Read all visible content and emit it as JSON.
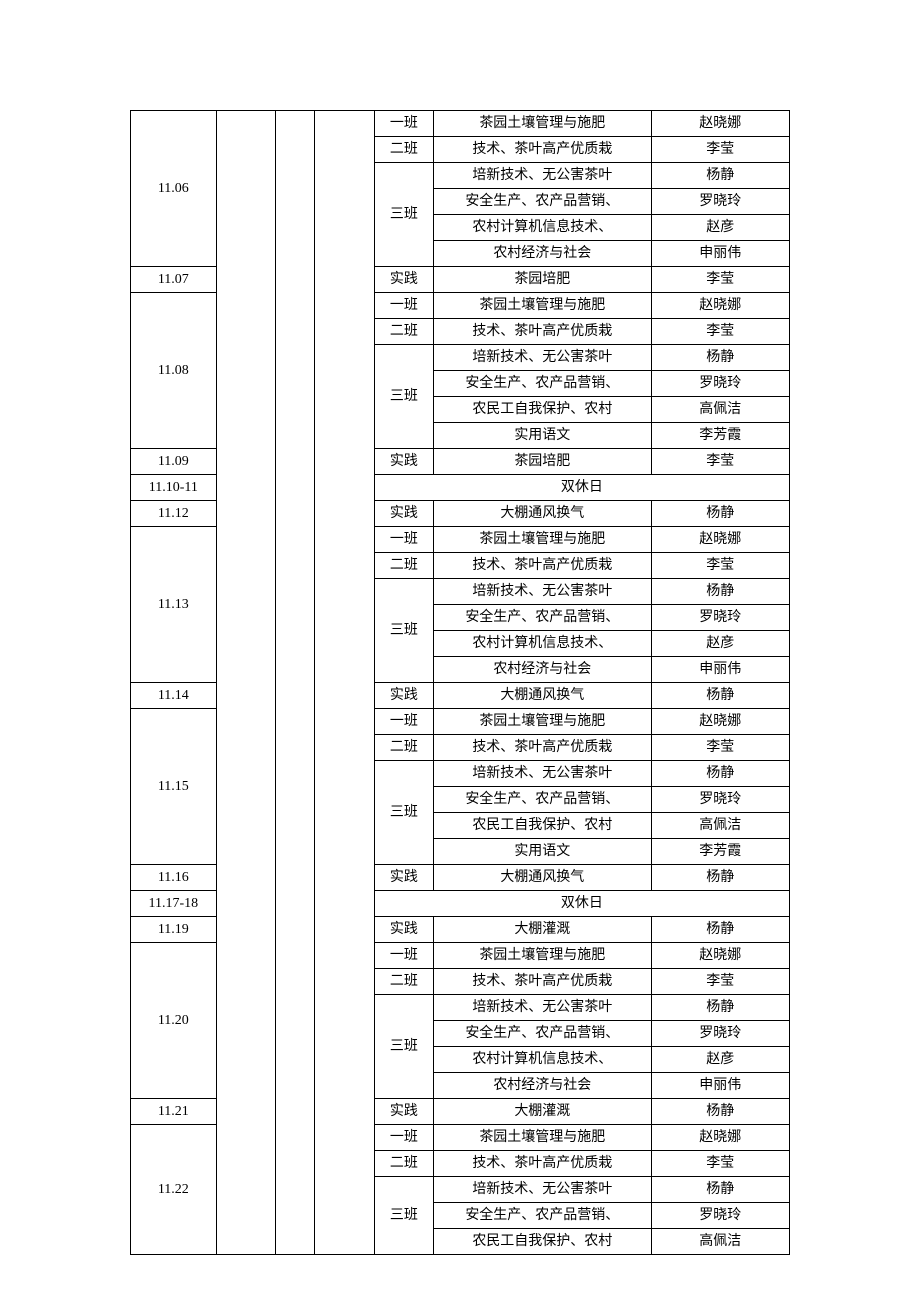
{
  "rows": [
    {
      "date": "11.06",
      "dateRows": 6,
      "classes": [
        {
          "cls": "一班",
          "clsRows": 1,
          "subject": "茶园土壤管理与施肥",
          "teacher": "赵晓娜"
        },
        {
          "cls": "二班",
          "clsRows": 1,
          "subject": "技术、茶叶高产优质栽",
          "teacher": "李莹"
        },
        {
          "cls": "三班",
          "clsRows": 4,
          "subject": "培新技术、无公害茶叶",
          "teacher": "杨静"
        },
        {
          "subject": "安全生产、农产品营销、",
          "teacher": "罗晓玲"
        },
        {
          "subject": "农村计算机信息技术、",
          "teacher": "赵彦"
        },
        {
          "subject": "农村经济与社会",
          "teacher": "申丽伟"
        }
      ]
    },
    {
      "date": "11.07",
      "dateRows": 1,
      "classes": [
        {
          "cls": "实践",
          "clsRows": 1,
          "subject": "茶园培肥",
          "teacher": "李莹"
        }
      ]
    },
    {
      "date": "11.08",
      "dateRows": 6,
      "classes": [
        {
          "cls": "一班",
          "clsRows": 1,
          "subject": "茶园土壤管理与施肥",
          "teacher": "赵晓娜"
        },
        {
          "cls": "二班",
          "clsRows": 1,
          "subject": "技术、茶叶高产优质栽",
          "teacher": "李莹"
        },
        {
          "cls": "三班",
          "clsRows": 4,
          "subject": "培新技术、无公害茶叶",
          "teacher": "杨静"
        },
        {
          "subject": "安全生产、农产品营销、",
          "teacher": "罗晓玲"
        },
        {
          "subject": "农民工自我保护、农村",
          "teacher": "高佩洁"
        },
        {
          "subject": "实用语文",
          "teacher": "李芳霞"
        }
      ]
    },
    {
      "date": "11.09",
      "dateRows": 1,
      "classes": [
        {
          "cls": "实践",
          "clsRows": 1,
          "subject": "茶园培肥",
          "teacher": "李莹"
        }
      ]
    },
    {
      "date": "11.10-11",
      "dateRows": 1,
      "holiday": "双休日"
    },
    {
      "date": "11.12",
      "dateRows": 1,
      "classes": [
        {
          "cls": "实践",
          "clsRows": 1,
          "subject": "大棚通风换气",
          "teacher": "杨静"
        }
      ]
    },
    {
      "date": "11.13",
      "dateRows": 6,
      "classes": [
        {
          "cls": "一班",
          "clsRows": 1,
          "subject": "茶园土壤管理与施肥",
          "teacher": "赵晓娜"
        },
        {
          "cls": "二班",
          "clsRows": 1,
          "subject": "技术、茶叶高产优质栽",
          "teacher": "李莹"
        },
        {
          "cls": "三班",
          "clsRows": 4,
          "subject": "培新技术、无公害茶叶",
          "teacher": "杨静"
        },
        {
          "subject": "安全生产、农产品营销、",
          "teacher": "罗晓玲"
        },
        {
          "subject": "农村计算机信息技术、",
          "teacher": "赵彦"
        },
        {
          "subject": "农村经济与社会",
          "teacher": "申丽伟"
        }
      ]
    },
    {
      "date": "11.14",
      "dateRows": 1,
      "classes": [
        {
          "cls": "实践",
          "clsRows": 1,
          "subject": "大棚通风换气",
          "teacher": "杨静"
        }
      ]
    },
    {
      "date": "11.15",
      "dateRows": 6,
      "classes": [
        {
          "cls": "一班",
          "clsRows": 1,
          "subject": "茶园土壤管理与施肥",
          "teacher": "赵晓娜"
        },
        {
          "cls": "二班",
          "clsRows": 1,
          "subject": "技术、茶叶高产优质栽",
          "teacher": "李莹"
        },
        {
          "cls": "三班",
          "clsRows": 4,
          "subject": "培新技术、无公害茶叶",
          "teacher": "杨静"
        },
        {
          "subject": "安全生产、农产品营销、",
          "teacher": "罗晓玲"
        },
        {
          "subject": "农民工自我保护、农村",
          "teacher": "高佩洁"
        },
        {
          "subject": "实用语文",
          "teacher": "李芳霞"
        }
      ]
    },
    {
      "date": "11.16",
      "dateRows": 1,
      "classes": [
        {
          "cls": "实践",
          "clsRows": 1,
          "subject": "大棚通风换气",
          "teacher": "杨静"
        }
      ]
    },
    {
      "date": "11.17-18",
      "dateRows": 1,
      "holiday": "双休日"
    },
    {
      "date": "11.19",
      "dateRows": 1,
      "classes": [
        {
          "cls": "实践",
          "clsRows": 1,
          "subject": "大棚灌溉",
          "teacher": "杨静"
        }
      ]
    },
    {
      "date": "11.20",
      "dateRows": 6,
      "classes": [
        {
          "cls": "一班",
          "clsRows": 1,
          "subject": "茶园土壤管理与施肥",
          "teacher": "赵晓娜"
        },
        {
          "cls": "二班",
          "clsRows": 1,
          "subject": "技术、茶叶高产优质栽",
          "teacher": "李莹"
        },
        {
          "cls": "三班",
          "clsRows": 4,
          "subject": "培新技术、无公害茶叶",
          "teacher": "杨静"
        },
        {
          "subject": "安全生产、农产品营销、",
          "teacher": "罗晓玲"
        },
        {
          "subject": "农村计算机信息技术、",
          "teacher": "赵彦"
        },
        {
          "subject": "农村经济与社会",
          "teacher": "申丽伟"
        }
      ]
    },
    {
      "date": "11.21",
      "dateRows": 1,
      "classes": [
        {
          "cls": "实践",
          "clsRows": 1,
          "subject": "大棚灌溉",
          "teacher": "杨静"
        }
      ]
    },
    {
      "date": "11.22",
      "dateRows": 5,
      "classes": [
        {
          "cls": "一班",
          "clsRows": 1,
          "subject": "茶园土壤管理与施肥",
          "teacher": "赵晓娜"
        },
        {
          "cls": "二班",
          "clsRows": 1,
          "subject": "技术、茶叶高产优质栽",
          "teacher": "李莹"
        },
        {
          "cls": "三班",
          "clsRows": 3,
          "subject": "培新技术、无公害茶叶",
          "teacher": "杨静"
        },
        {
          "subject": "安全生产、农产品营销、",
          "teacher": "罗晓玲"
        },
        {
          "subject": "农民工自我保护、农村",
          "teacher": "高佩洁"
        }
      ]
    }
  ]
}
